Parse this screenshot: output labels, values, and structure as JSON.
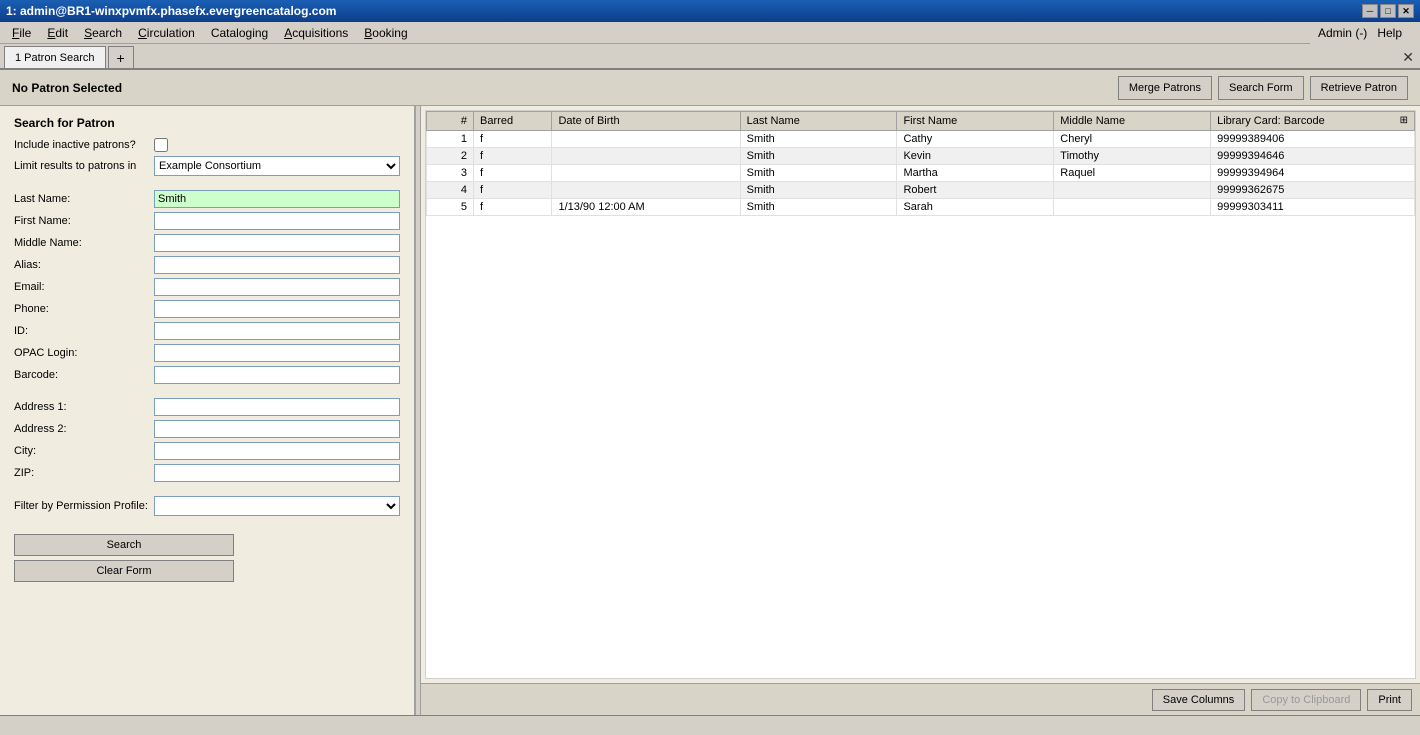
{
  "titlebar": {
    "title": "1: admin@BR1-winxpvmfx.phasefx.evergreencatalog.com",
    "minimize": "─",
    "maximize": "□",
    "close": "✕"
  },
  "menubar": {
    "items": [
      {
        "label": "File",
        "underline_index": 0
      },
      {
        "label": "Edit",
        "underline_index": 0
      },
      {
        "label": "Search",
        "underline_index": 0
      },
      {
        "label": "Circulation",
        "underline_index": 0
      },
      {
        "label": "Cataloging",
        "underline_index": 0
      },
      {
        "label": "Acquisitions",
        "underline_index": 0
      },
      {
        "label": "Booking",
        "underline_index": 0
      }
    ],
    "admin_label": "Admin (-)",
    "help_label": "Help"
  },
  "tabs": [
    {
      "label": "1 Patron Search",
      "active": true
    },
    {
      "label": "+",
      "is_add": true
    }
  ],
  "window_close": "✕",
  "patron_header": {
    "title": "No Patron Selected",
    "buttons": {
      "merge": "Merge Patrons",
      "search_form": "Search Form",
      "retrieve": "Retrieve Patron"
    }
  },
  "search_form": {
    "title": "Search for Patron",
    "include_inactive_label": "Include inactive patrons?",
    "limit_results_label": "Limit results to patrons in",
    "limit_results_value": "Example Consortium",
    "last_name_label": "Last Name:",
    "last_name_value": "Smith",
    "first_name_label": "First Name:",
    "first_name_value": "",
    "middle_name_label": "Middle Name:",
    "middle_name_value": "",
    "alias_label": "Alias:",
    "alias_value": "",
    "email_label": "Email:",
    "email_value": "",
    "phone_label": "Phone:",
    "phone_value": "",
    "id_label": "ID:",
    "id_value": "",
    "opac_login_label": "OPAC Login:",
    "opac_login_value": "",
    "barcode_label": "Barcode:",
    "barcode_value": "",
    "address1_label": "Address 1:",
    "address1_value": "",
    "address2_label": "Address 2:",
    "address2_value": "",
    "city_label": "City:",
    "city_value": "",
    "zip_label": "ZIP:",
    "zip_value": "",
    "filter_label": "Filter by Permission Profile:",
    "filter_value": "",
    "search_btn": "Search",
    "clear_btn": "Clear Form"
  },
  "results": {
    "columns": [
      "#",
      "Barred",
      "Date of Birth",
      "Last Name",
      "First Name",
      "Middle Name",
      "Library Card: Barcode"
    ],
    "rows": [
      {
        "num": "1",
        "barred": "f",
        "dob": "",
        "last_name": "Smith",
        "first_name": "Cathy",
        "middle": "Cheryl",
        "card": "99999389406"
      },
      {
        "num": "2",
        "barred": "f",
        "dob": "",
        "last_name": "Smith",
        "first_name": "Kevin",
        "middle": "Timothy",
        "card": "99999394646"
      },
      {
        "num": "3",
        "barred": "f",
        "dob": "",
        "last_name": "Smith",
        "first_name": "Martha",
        "middle": "Raquel",
        "card": "99999394964"
      },
      {
        "num": "4",
        "barred": "f",
        "dob": "",
        "last_name": "Smith",
        "first_name": "Robert",
        "middle": "",
        "card": "99999362675"
      },
      {
        "num": "5",
        "barred": "f",
        "dob": "1/13/90 12:00 AM",
        "last_name": "Smith",
        "first_name": "Sarah",
        "middle": "",
        "card": "99999303411"
      }
    ],
    "bottom_buttons": {
      "save_columns": "Save Columns",
      "copy_clipboard": "Copy to Clipboard",
      "print": "Print"
    }
  },
  "statusbar": {
    "text": ""
  }
}
